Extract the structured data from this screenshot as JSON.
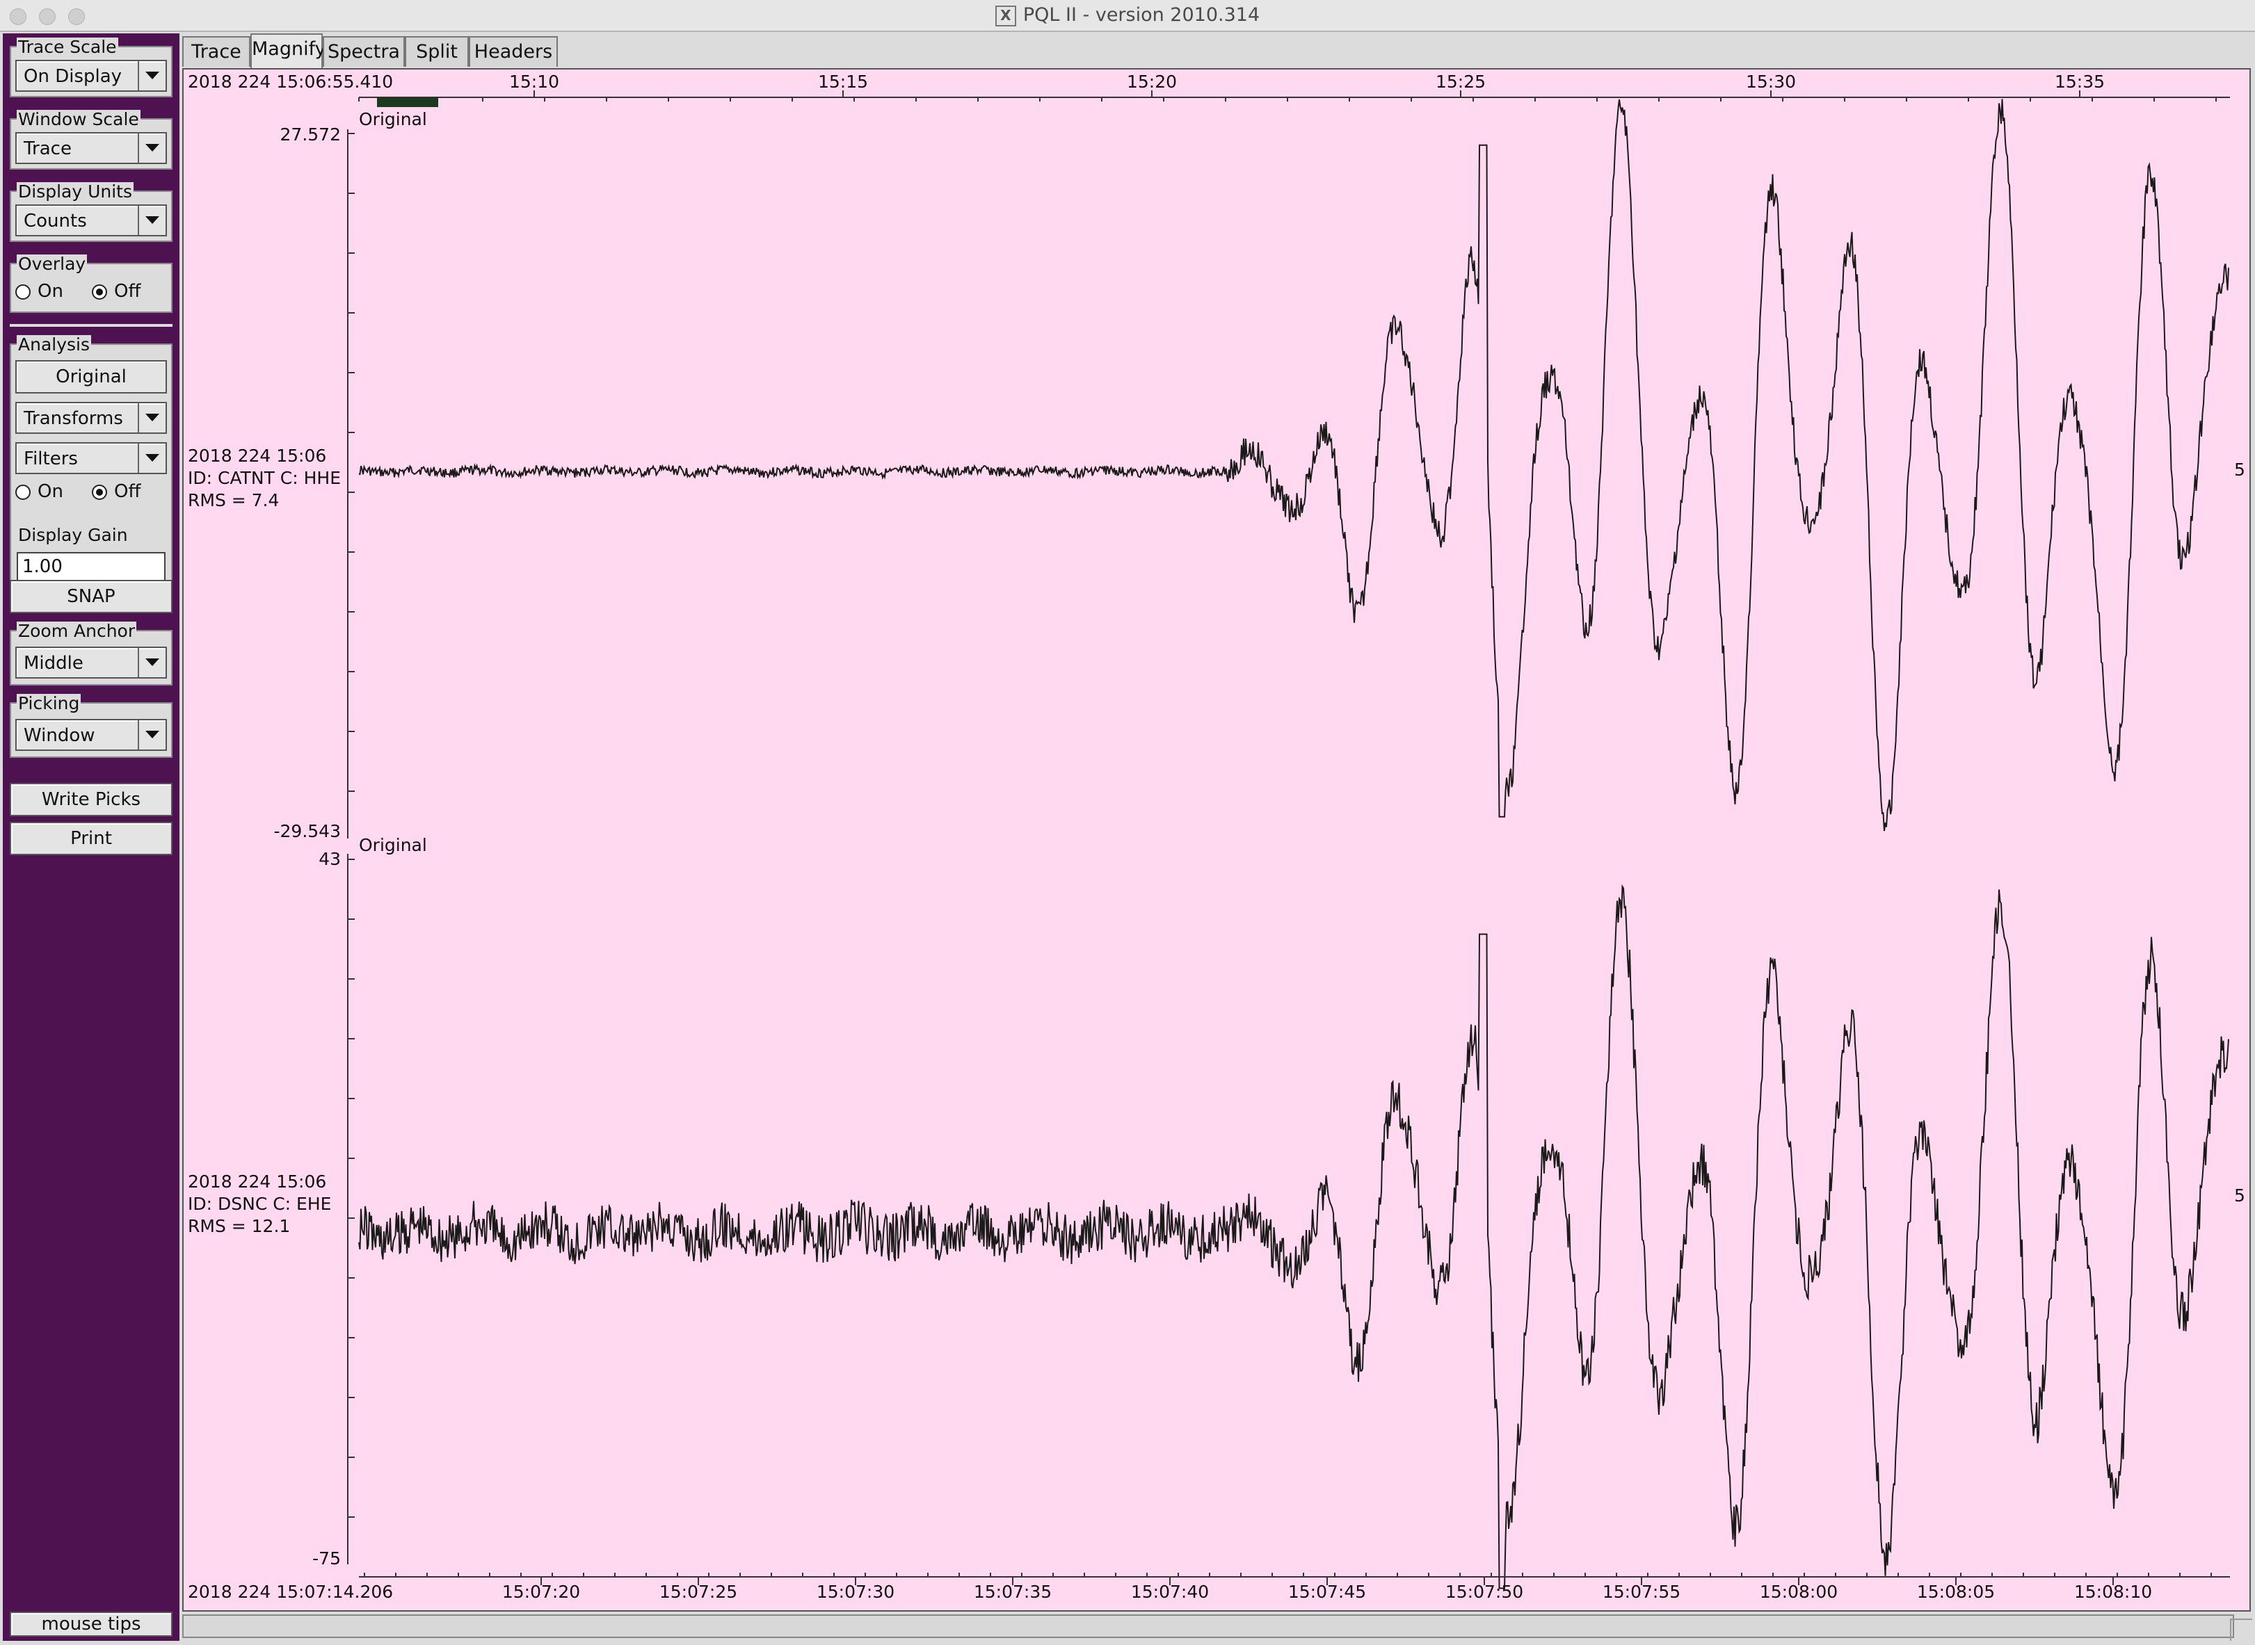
{
  "window": {
    "title": "PQL II - version 2010.314",
    "x_logo": "X"
  },
  "tabs": [
    {
      "label": "Trace"
    },
    {
      "label": "Magnify"
    },
    {
      "label": "Spectra"
    },
    {
      "label": "Split"
    },
    {
      "label": "Headers"
    }
  ],
  "active_tab": "Magnify",
  "sidebar": {
    "trace_scale": {
      "label": "Trace Scale",
      "value": "On Display"
    },
    "window_scale": {
      "label": "Window Scale",
      "value": "Trace"
    },
    "display_units": {
      "label": "Display Units",
      "value": "Counts"
    },
    "overlay": {
      "label": "Overlay",
      "on": "On",
      "off": "Off",
      "selected": "Off"
    },
    "analysis": {
      "label": "Analysis",
      "original": "Original",
      "transforms": "Transforms",
      "filters": "Filters",
      "on": "On",
      "off": "Off",
      "selected": "Off"
    },
    "display_gain": {
      "label": "Display Gain",
      "value": "1.00"
    },
    "snap": "SNAP",
    "zoom_anchor": {
      "label": "Zoom Anchor",
      "value": "Middle"
    },
    "picking": {
      "label": "Picking",
      "value": "Window"
    },
    "write_picks": "Write Picks",
    "print": "Print",
    "mouse_tips": "mouse tips"
  },
  "top_axis": {
    "start_label": "2018 224 15:06:55.410",
    "ticks": [
      "15:10",
      "15:15",
      "15:20",
      "15:25",
      "15:30",
      "15:35"
    ]
  },
  "bottom_axis": {
    "start_label": "2018 224 15:07:14.206",
    "ticks": [
      "15:07:20",
      "15:07:25",
      "15:07:30",
      "15:07:35",
      "15:07:40",
      "15:07:45",
      "15:07:50",
      "15:07:55",
      "15:08:00",
      "15:08:05",
      "15:08:10"
    ]
  },
  "traces": [
    {
      "label": "Original",
      "ymax": "27.572",
      "ymin": "-29.543",
      "time": "2018 224 15:06",
      "id": "ID: CATNT C: HHE",
      "rms": "RMS = 7.4",
      "right_mark": "5"
    },
    {
      "label": "Original",
      "ymax": "43",
      "ymin": "-75",
      "time": "2018 224 15:06",
      "id": "ID: DSNC C: EHE",
      "rms": "RMS = 12.1",
      "right_mark": "5"
    }
  ],
  "colors": {
    "sidebar": "#4e1250",
    "plot_bg": "#ffd9ef",
    "trace": "#1a1a1a",
    "window_marker": "#1c3a1c"
  }
}
